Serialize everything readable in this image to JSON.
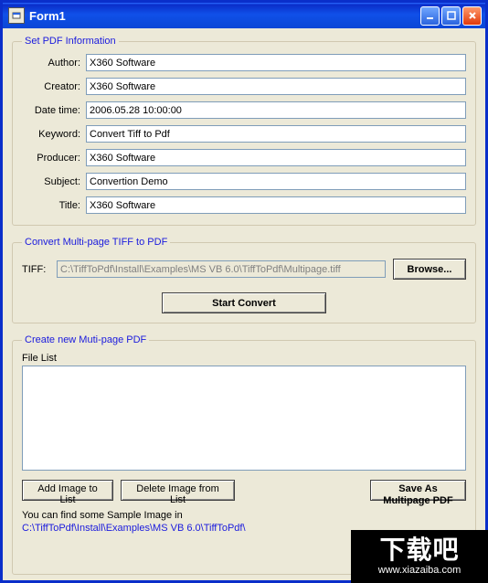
{
  "window": {
    "title": "Form1"
  },
  "groups": {
    "pdf_info": "Set PDF Information",
    "convert": "Convert Multi-page TIFF to PDF",
    "create": "Create new Muti-page PDF"
  },
  "pdf": {
    "author_label": "Author:",
    "author": "X360 Software",
    "creator_label": "Creator:",
    "creator": "X360 Software",
    "datetime_label": "Date time:",
    "datetime": "2006.05.28 10:00:00",
    "keyword_label": "Keyword:",
    "keyword": "Convert Tiff to Pdf",
    "producer_label": "Producer:",
    "producer": "X360 Software",
    "subject_label": "Subject:",
    "subject": "Convertion Demo",
    "title_label": "Title:",
    "title": "X360 Software"
  },
  "convert": {
    "tiff_label": "TIFF:",
    "tiff_path": "C:\\TiffToPdf\\Install\\Examples\\MS VB 6.0\\TiffToPdf\\Multipage.tiff",
    "browse": "Browse...",
    "start": "Start Convert"
  },
  "create": {
    "file_list_label": "File List",
    "add": "Add Image to List",
    "delete": "Delete Image from List",
    "save": "Save As Multipage PDF",
    "sample_text": "You can find some Sample Image in",
    "sample_path": "C:\\TiffToPdf\\Install\\Examples\\MS VB 6.0\\TiffToPdf\\"
  },
  "watermark": {
    "big": "下载吧",
    "small": "www.xiazaiba.com"
  }
}
